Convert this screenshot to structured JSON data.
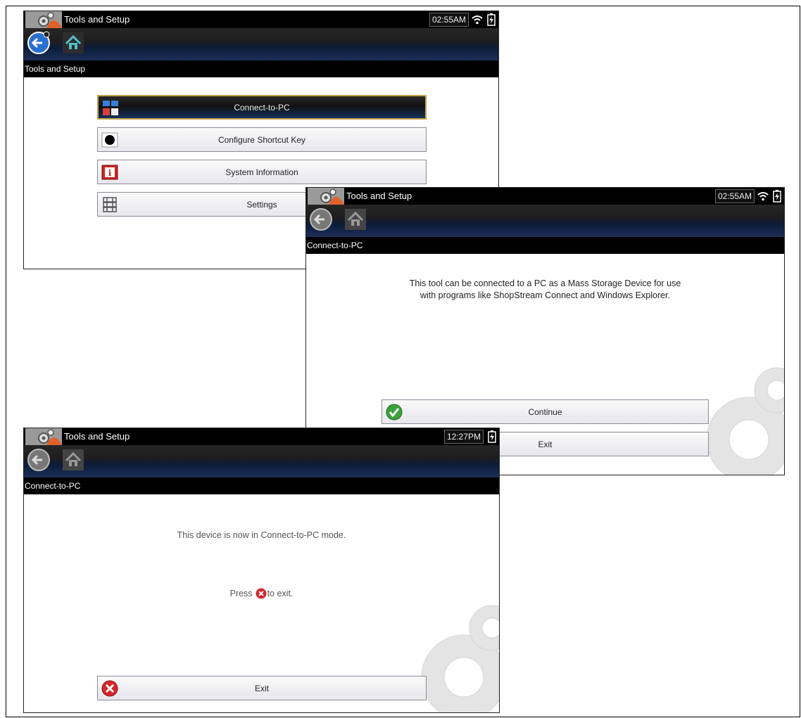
{
  "screen1": {
    "title": "Tools and Setup",
    "time": "02:55AM",
    "breadcrumb": "Tools and Setup",
    "menu": [
      {
        "label": "Connect-to-PC",
        "icon": "connect-pc-icon"
      },
      {
        "label": "Configure Shortcut Key",
        "icon": "shortcut-key-icon"
      },
      {
        "label": "System Information",
        "icon": "info-icon"
      },
      {
        "label": "Settings",
        "icon": "settings-icon"
      }
    ]
  },
  "screen2": {
    "title": "Tools and Setup",
    "time": "02:55AM",
    "breadcrumb": "Connect-to-PC",
    "message_line1": "This tool can be connected to a PC as a Mass Storage Device for use",
    "message_line2": "with programs like ShopStream Connect and Windows Explorer.",
    "continue_label": "Continue",
    "exit_label": "Exit"
  },
  "screen3": {
    "title": "Tools and Setup",
    "time": "12:27PM",
    "breadcrumb": "Connect-to-PC",
    "message_mode": "This device is now in Connect-to-PC mode.",
    "press_prefix": "Press",
    "press_suffix": "to exit.",
    "exit_label": "Exit"
  },
  "colors": {
    "accent_blue": "#2a6fd0",
    "continue_green": "#3aa23a",
    "exit_red": "#d7262c",
    "selected_border": "#c2a14a"
  }
}
